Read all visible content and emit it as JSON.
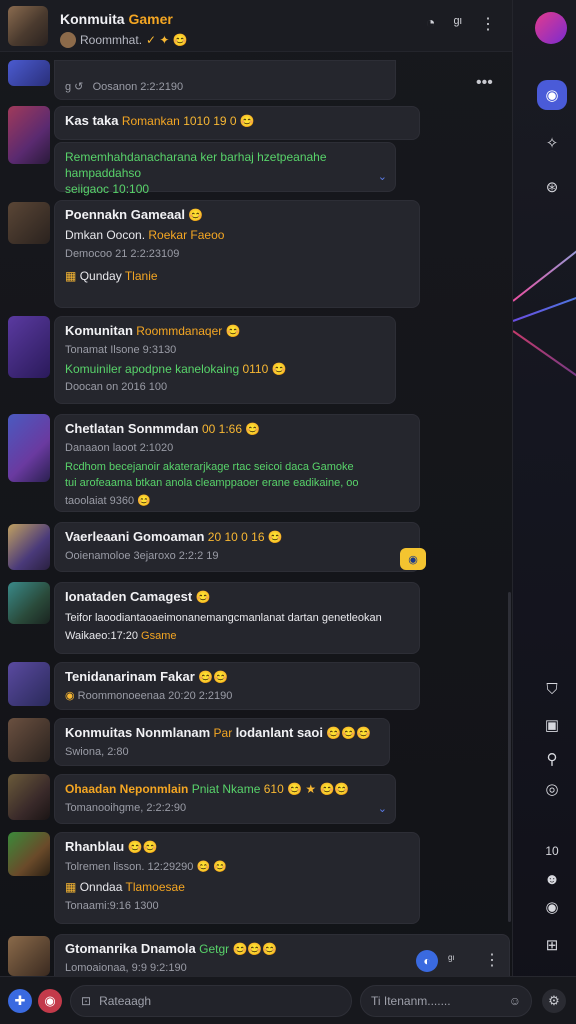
{
  "header": {
    "title_main": "Konmuita",
    "title_accent": "Gamer",
    "subtitle": "Roommhat.",
    "subtitle_emojis": "✓ ✦ 😊"
  },
  "messages": [
    {
      "meta": "Oosanon 2:2:2190"
    },
    {
      "name": "Kas taka",
      "tag": "Romankan",
      "badges": "1010 19 0 😊",
      "text": "Rememhahdanacharana ker barhaj hzetpeanahe hampaddahso",
      "text2": "seiigaoc 10:100"
    },
    {
      "name": "Poennakn Gameaal",
      "badge": "😊",
      "line1": "Dmkan Oocon.",
      "line1_accent": "Roekar Faeoo",
      "meta": "Democoo 21 2:2:23109",
      "tag": "Qunday",
      "tag_accent": "Tlanie"
    },
    {
      "name": "Komunitan",
      "name_accent": "Roommdanaqer",
      "badge": "😊",
      "meta": "Tonamat Ilsone 9:3130",
      "text": "Komuiniler apodpne kanelokaing",
      "text_badge": "0110 😊",
      "meta2": "Doocan on 2016 100"
    },
    {
      "name": "Chetlatan Sonmmdan",
      "badges": "00 1:66 😊",
      "meta": "Danaaon laoot 2:1020",
      "text": "Rcdhom becejanoir akaterarjkage rtac seicoi daca Gamoke",
      "text2": "tui arofeaama btkan anola cleamppaoer erane eadikaine, oo",
      "meta2": "taoolaiat 9360 😊"
    },
    {
      "name": "Vaerleaani Gomoaman",
      "badges": "20 10 0 16 😊",
      "meta": "Ooienamoloe 3ejaroxo 2:2:2 19"
    },
    {
      "name": "Ionataden Camagest",
      "badge": "😊",
      "text": "Teifor laoodiantaoaeimonanemangcmanlanat dartan genetleokan",
      "text2": "Waikaeo:17:20",
      "text2_accent": "Gsame"
    },
    {
      "name": "Tenidanarinam Fakar",
      "badges": "😊😊",
      "meta": "Roommonoeenaa 20:20 2:2190"
    },
    {
      "name": "Konmuitas Nonmlanam",
      "name_accent": "Par",
      "name_rest": "lodanlant saoi",
      "badges": "😊😊😊",
      "meta": "Swiona, 2:80"
    },
    {
      "name": "Ohaadan Neponmlain",
      "name_accent": "Pniat Nkame",
      "badges": "610 😊 ★ 😊😊",
      "meta": "Tomanooihgme, 2:2:2:90"
    },
    {
      "name": "Rhanblau",
      "badges": "😊😊",
      "meta": "Tolremen lisson. 12:29290",
      "meta_badges": "😊 😊",
      "tag": "Onndaa",
      "tag_accent": "Tlamoesae",
      "meta2": "Tonaami:9:16 1300"
    },
    {
      "name": "Gtomanrika Dnamola",
      "name_accent": "Getgr",
      "badges": "😊😊😊",
      "meta": "Lomoaionaa, 9:9 9:2:190"
    }
  ],
  "rail": {
    "number": "10"
  },
  "composer": {
    "left_placeholder": "Rateaagh",
    "right_placeholder": "Ti Itenanm......."
  },
  "colors": {
    "accent": "#4a5bd8",
    "green": "#58d36a",
    "orange": "#f4a623",
    "bg": "#121318"
  }
}
